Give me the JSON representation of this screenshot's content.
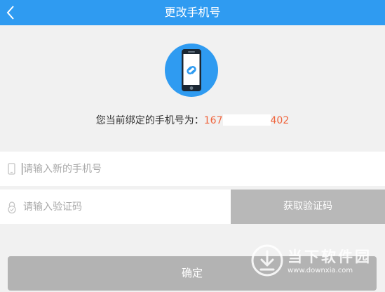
{
  "header": {
    "title": "更改手机号"
  },
  "current": {
    "label": "您当前绑定的手机号为：",
    "number_visible_start": "167",
    "number_visible_end": "402"
  },
  "form": {
    "phone_placeholder": "请输入新的手机号",
    "code_placeholder": "请输入验证码",
    "get_code_label": "获取验证码",
    "confirm_label": "确定"
  },
  "watermark": {
    "name": "当下软件园",
    "url": "www.downxia.com"
  },
  "colors": {
    "accent": "#2f9bf1",
    "number": "#f0643c",
    "disabled_button": "#b8b8b8",
    "background": "#f1f1f1"
  },
  "icons": {
    "back": "chevron-left-icon",
    "phone_illustration": "phone-link-icon",
    "phone_field": "phone-icon",
    "code_field": "lock-icon"
  }
}
